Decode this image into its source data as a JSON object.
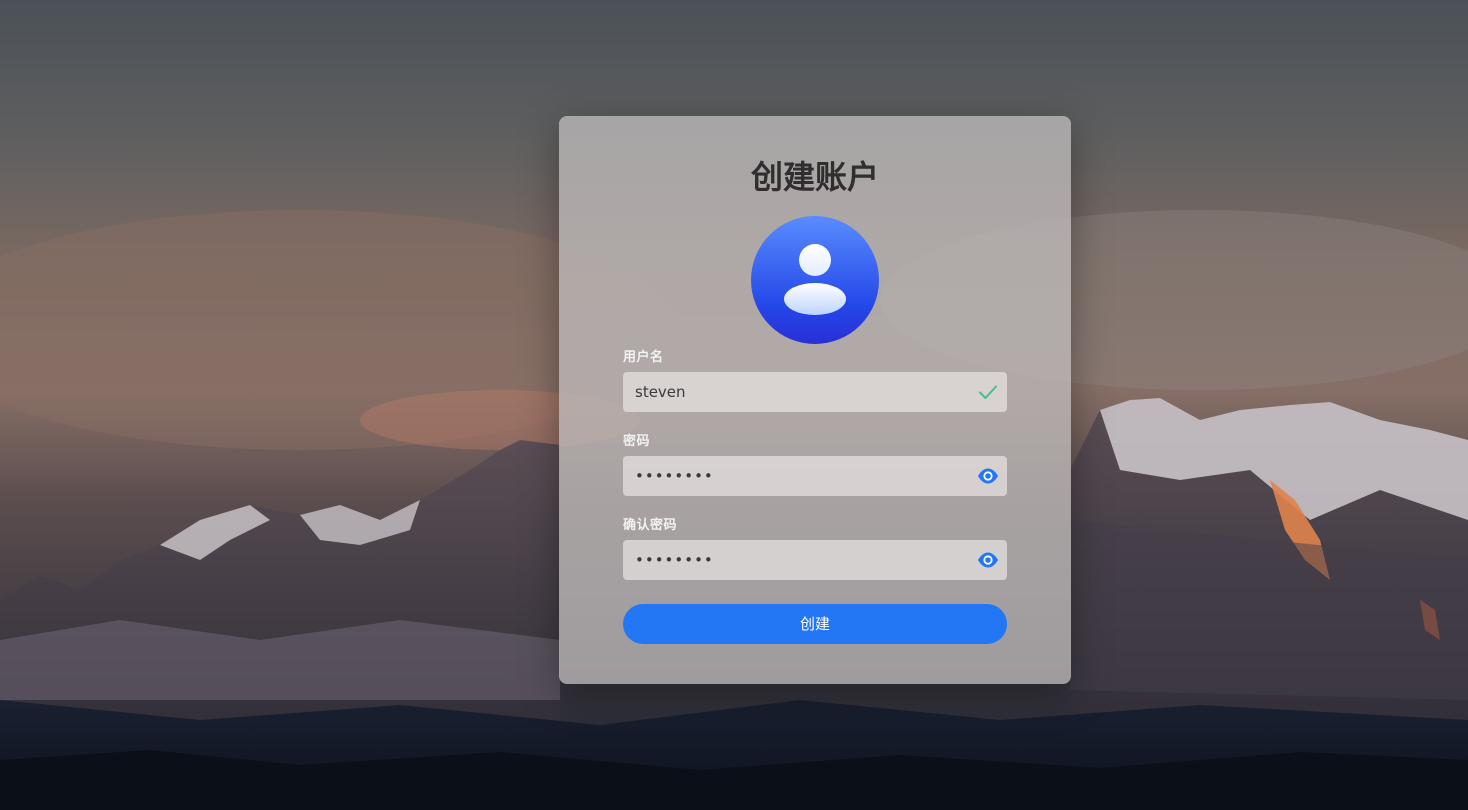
{
  "title": "创建账户",
  "avatar_icon": "user-avatar-icon",
  "fields": {
    "username": {
      "label": "用户名",
      "value": "steven",
      "status_icon": "check-icon"
    },
    "password": {
      "label": "密码",
      "value": "••••••••",
      "toggle_icon": "eye-icon"
    },
    "confirm_password": {
      "label": "确认密码",
      "value": "••••••••",
      "toggle_icon": "eye-icon"
    }
  },
  "submit_label": "创建",
  "colors": {
    "accent": "#2377f5",
    "check": "#3ec28f",
    "eye": "#2377f5"
  }
}
